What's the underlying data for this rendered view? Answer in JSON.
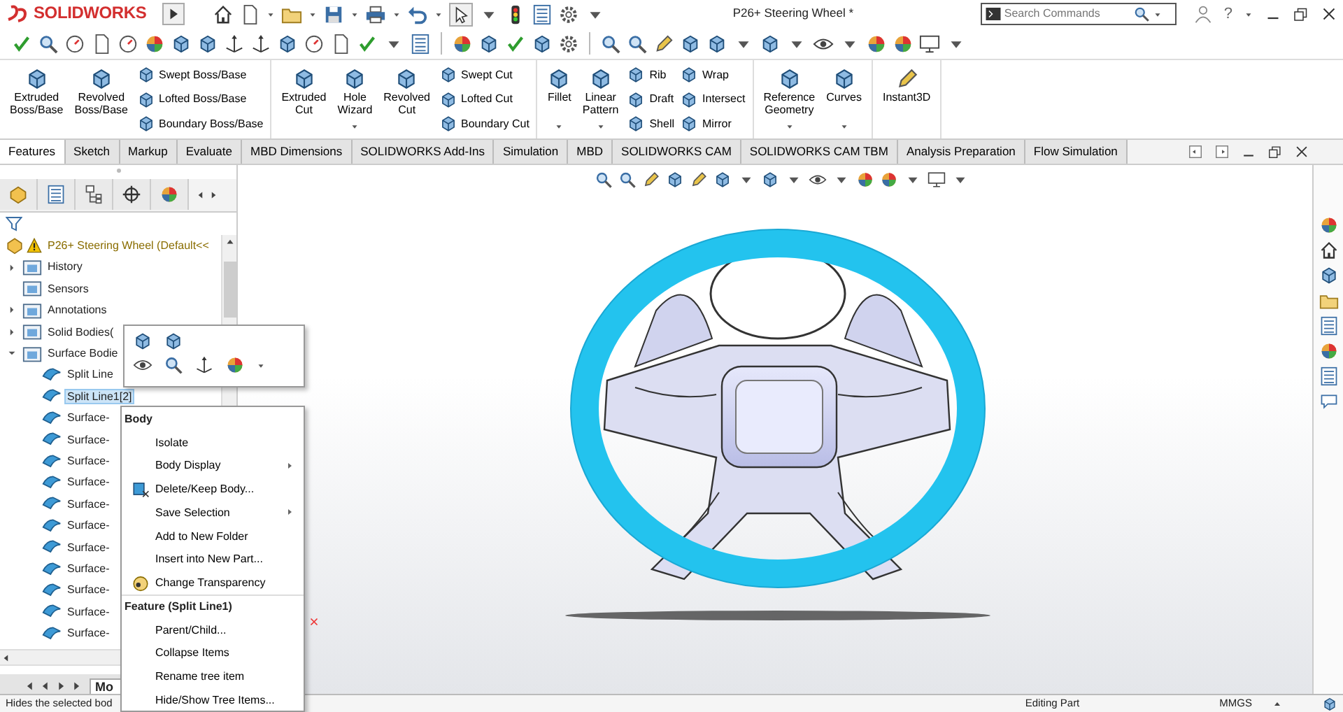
{
  "title_bar": {
    "logo": "SOLIDWORKS",
    "title": "P26+ Steering Wheel *",
    "search": {
      "placeholder": "Search Commands"
    },
    "help": "?"
  },
  "ribbon": [
    {
      "items": [
        {
          "kind": "large",
          "label": "Extruded\nBoss/Base",
          "dropdown": false
        },
        {
          "kind": "large",
          "label": "Revolved\nBoss/Base",
          "dropdown": false
        },
        {
          "kind": "stack",
          "labels": [
            "Swept Boss/Base",
            "Lofted Boss/Base",
            "Boundary Boss/Base"
          ]
        }
      ]
    },
    {
      "items": [
        {
          "kind": "large",
          "label": "Extruded\nCut",
          "dropdown": false
        },
        {
          "kind": "large",
          "label": "Hole\nWizard",
          "dropdown": true
        },
        {
          "kind": "large",
          "label": "Revolved\nCut",
          "dropdown": false
        },
        {
          "kind": "stack",
          "labels": [
            "Swept Cut",
            "Lofted Cut",
            "Boundary Cut"
          ]
        }
      ]
    },
    {
      "items": [
        {
          "kind": "large",
          "label": "Fillet",
          "dropdown": true
        },
        {
          "kind": "large",
          "label": "Linear\nPattern",
          "dropdown": true
        },
        {
          "kind": "stack",
          "labels": [
            "Rib",
            "Draft",
            "Shell"
          ]
        },
        {
          "kind": "stack",
          "labels": [
            "Wrap",
            "Intersect",
            "Mirror"
          ]
        }
      ]
    },
    {
      "items": [
        {
          "kind": "large",
          "label": "Reference\nGeometry",
          "dropdown": true
        },
        {
          "kind": "large",
          "label": "Curves",
          "dropdown": true
        }
      ]
    },
    {
      "items": [
        {
          "kind": "large",
          "label": "Instant3D",
          "dropdown": false
        }
      ]
    }
  ],
  "tabs": [
    {
      "label": "Features",
      "selected": true
    },
    {
      "label": "Sketch",
      "selected": false
    },
    {
      "label": "Markup",
      "selected": false
    },
    {
      "label": "Evaluate",
      "selected": false
    },
    {
      "label": "MBD Dimensions",
      "selected": false
    },
    {
      "label": "SOLIDWORKS Add-Ins",
      "selected": false
    },
    {
      "label": "Simulation",
      "selected": false
    },
    {
      "label": "MBD",
      "selected": false
    },
    {
      "label": "SOLIDWORKS CAM",
      "selected": false
    },
    {
      "label": "SOLIDWORKS CAM TBM",
      "selected": false
    },
    {
      "label": "Analysis Preparation",
      "selected": false
    },
    {
      "label": "Flow Simulation",
      "selected": false
    }
  ],
  "tree": {
    "root": {
      "label": "P26+ Steering Wheel  (Default<<",
      "warning": true
    },
    "items": [
      {
        "label": "History",
        "kind": "folder",
        "expanded": false,
        "selected": false
      },
      {
        "label": "Sensors",
        "kind": "folder",
        "selected": false
      },
      {
        "label": "Annotations",
        "kind": "folder",
        "expanded": false,
        "selected": false
      },
      {
        "label": "Solid Bodies(",
        "kind": "folder",
        "expanded": false,
        "selected": false
      },
      {
        "label": "Surface Bodie",
        "kind": "folder",
        "expanded": true,
        "selected": false,
        "children": [
          {
            "label": "Split Line",
            "kind": "body",
            "selected": false
          },
          {
            "label": "Split Line1[2]",
            "kind": "body",
            "selected": true
          },
          {
            "label": "Surface-",
            "kind": "body",
            "selected": false
          },
          {
            "label": "Surface-",
            "kind": "body",
            "selected": false
          },
          {
            "label": "Surface-",
            "kind": "body",
            "selected": false
          },
          {
            "label": "Surface-",
            "kind": "body",
            "selected": false
          },
          {
            "label": "Surface-",
            "kind": "body",
            "selected": false
          },
          {
            "label": "Surface-",
            "kind": "body",
            "selected": false
          },
          {
            "label": "Surface-",
            "kind": "body",
            "selected": false
          },
          {
            "label": "Surface-",
            "kind": "body",
            "selected": false
          },
          {
            "label": "Surface-",
            "kind": "body",
            "selected": false
          },
          {
            "label": "Surface-",
            "kind": "body",
            "selected": false
          },
          {
            "label": "Surface-",
            "kind": "body",
            "selected": false
          }
        ]
      }
    ],
    "bottom_tab": "Mo"
  },
  "context_menu": {
    "sections": [
      {
        "heading": "Body",
        "items": [
          {
            "label": "Isolate",
            "submenu": false,
            "has_icon": false
          },
          {
            "label": "Body Display",
            "submenu": true,
            "has_icon": false
          },
          {
            "label": "Delete/Keep Body...",
            "submenu": false,
            "has_icon": true
          },
          {
            "label": "Save Selection",
            "submenu": true,
            "has_icon": false
          },
          {
            "label": "Add to New Folder",
            "submenu": false,
            "has_icon": false
          },
          {
            "label": "Insert into New Part...",
            "submenu": false,
            "has_icon": false
          },
          {
            "label": "Change Transparency",
            "submenu": false,
            "has_icon": true
          }
        ]
      },
      {
        "heading": "Feature (Split Line1)",
        "items": [
          {
            "label": "Parent/Child...",
            "submenu": false,
            "has_icon": false
          },
          {
            "label": "Collapse Items",
            "submenu": false,
            "has_icon": false
          },
          {
            "label": "Rename tree item",
            "submenu": false,
            "has_icon": false
          },
          {
            "label": "Hide/Show Tree Items...",
            "submenu": false,
            "has_icon": false
          }
        ]
      }
    ]
  },
  "status_bar": {
    "message": "Hides the selected bod",
    "mode": "Editing Part",
    "units": "MMGS"
  }
}
